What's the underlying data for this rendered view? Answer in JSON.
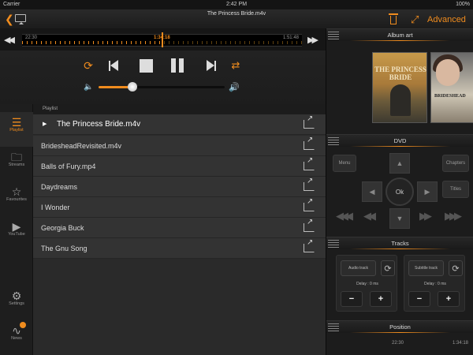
{
  "status": {
    "carrier": "Carrier",
    "time": "2:42 PM",
    "battery": "100%"
  },
  "header": {
    "title": "The Princess Bride.m4v",
    "advanced_label": "Advanced"
  },
  "seek": {
    "elapsed": "22:30",
    "current": "1:34:18",
    "total": "1:51:48",
    "progress_fraction": 0.5
  },
  "volume": {
    "level_fraction": 0.27
  },
  "accent_color": "#f08c1e",
  "tabs": [
    {
      "label": "Playlist",
      "icon": "list-icon",
      "active": true
    },
    {
      "label": "Streams",
      "icon": "folder-icon",
      "active": false
    },
    {
      "label": "Favourites",
      "icon": "star-icon",
      "active": false
    },
    {
      "label": "YouTube",
      "icon": "youtube-icon",
      "active": false
    },
    {
      "label": "Settings",
      "icon": "gear-icon",
      "active": false
    },
    {
      "label": "News",
      "icon": "rss-icon",
      "active": false
    }
  ],
  "playlist": {
    "header": "Playlist",
    "items": [
      {
        "name": "The Princess Bride.m4v",
        "playing": true
      },
      {
        "name": "BridesheadRevisited.m4v",
        "playing": false
      },
      {
        "name": "Balls of Fury.mp4",
        "playing": false
      },
      {
        "name": "Daydreams",
        "playing": false
      },
      {
        "name": "I Wonder",
        "playing": false
      },
      {
        "name": "Georgia Buck",
        "playing": false
      },
      {
        "name": "The Gnu Song",
        "playing": false
      }
    ]
  },
  "panels": {
    "album_art": "Album art",
    "poster_1_title": "THE PRINCESS BRIDE",
    "poster_2_title": "BRIDESHEAD",
    "dvd": "DVD",
    "dvd_menu": "Menu",
    "dvd_chapters": "Chapters",
    "dvd_titles": "Titles",
    "dvd_ok": "Ok",
    "tracks": "Tracks",
    "audio_track": "Audio track",
    "subtitle_track": "Subtitle track",
    "audio_delay": "Delay : 0 ms",
    "subtitle_delay": "Delay : 0 ms",
    "position": "Position",
    "position_start": "22:30",
    "position_end": "1:34:18"
  }
}
